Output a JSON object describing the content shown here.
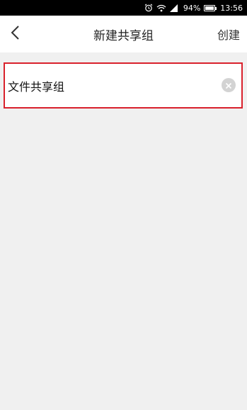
{
  "status_bar": {
    "battery": "94%",
    "battery_level": 0.94,
    "time": "13:56",
    "icons": [
      "alarm-icon",
      "wifi-icon",
      "signal-icon",
      "battery-icon"
    ]
  },
  "header": {
    "title": "新建共享组",
    "create_label": "创建",
    "back_icon": "chevron-left-icon"
  },
  "form": {
    "group_name_value": "文件共享组",
    "clear_icon": "clear-icon",
    "highlight_color": "#d9212c"
  }
}
